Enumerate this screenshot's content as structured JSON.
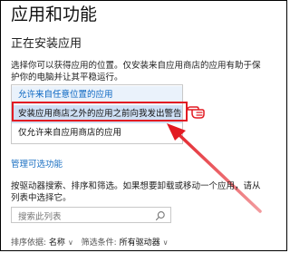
{
  "page": {
    "title": "应用和功能",
    "section_heading": "正在安装应用",
    "description_lines": [
      "选择你可以获得应用的位置。仅安装来自应用商店的应用有助于保",
      "护你的电脑并让其平稳运行。"
    ]
  },
  "install_source_dropdown": {
    "options": [
      "允许来自任意位置的应用",
      "安装应用商店之外的应用之前向我发出警告",
      "仅允许来自应用商店的应用"
    ],
    "selected_index": 1
  },
  "manage_optional_features_link": "管理可选功能",
  "filter_description_lines": [
    "按驱动器搜索、排序和筛选。如果想要卸载或移动一个应用，请从",
    "列表中选择它。"
  ],
  "search": {
    "placeholder": "搜索此列表",
    "icon": "search-icon"
  },
  "sort": {
    "label": "排序依据:",
    "value": "名称"
  },
  "filter": {
    "label": "筛选条件:",
    "value": "所有驱动器"
  },
  "annotation": {
    "color": "#e21b23",
    "pointer_icon": "pointing-hand-icon"
  }
}
